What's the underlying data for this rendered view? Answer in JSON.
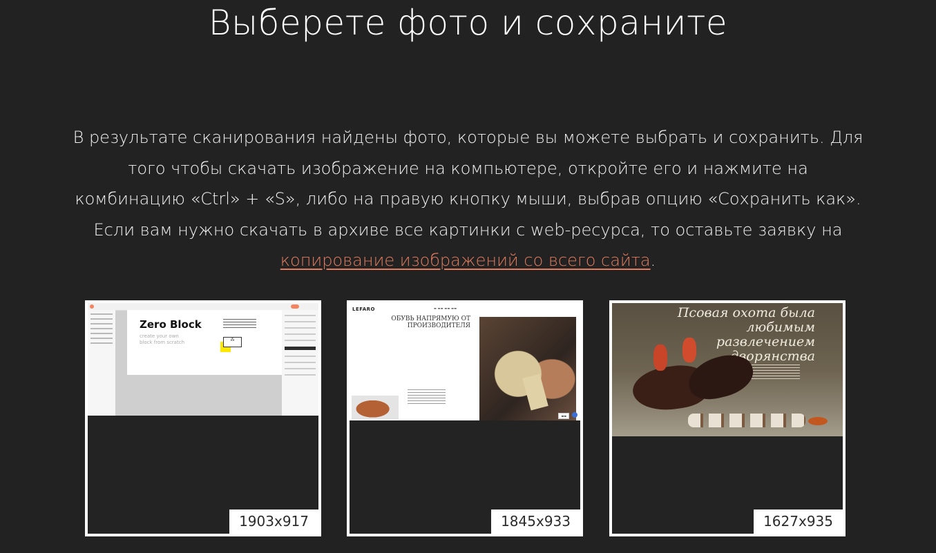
{
  "page": {
    "title": "Выберете фото и сохраните",
    "description_text": "В результате сканирования найдены фото, которые вы можете выбрать и сохранить. Для того чтобы скачать изображение на компьютере, откройте его и нажмите на комбинацию «Ctrl» + «S», либо на правую кнопку мыши, выбрав опцию «Сохранить как». Если вам нужно скачать в архиве все картинки с web-ресурса, то оставьте заявку на ",
    "description_link": "копирование изображений со всего сайта",
    "description_end": "."
  },
  "colors": {
    "background": "#222222",
    "link": "#e27d5f",
    "card_border": "#ffffff"
  },
  "images": [
    {
      "size": "1903x917",
      "thumb_text": {
        "heading": "Zero Block",
        "subtitle": "create your own block from scratch"
      }
    },
    {
      "size": "1845x933",
      "thumb_text": {
        "brand": "LEFARO",
        "headline": "ОБУВЬ НАПРЯМУЮ ОТ ПРОИЗВОДИТЕЛЯ"
      }
    },
    {
      "size": "1627x935",
      "thumb_text": {
        "heading": "Псовая охота была любимым развлечением дворянства"
      }
    }
  ]
}
